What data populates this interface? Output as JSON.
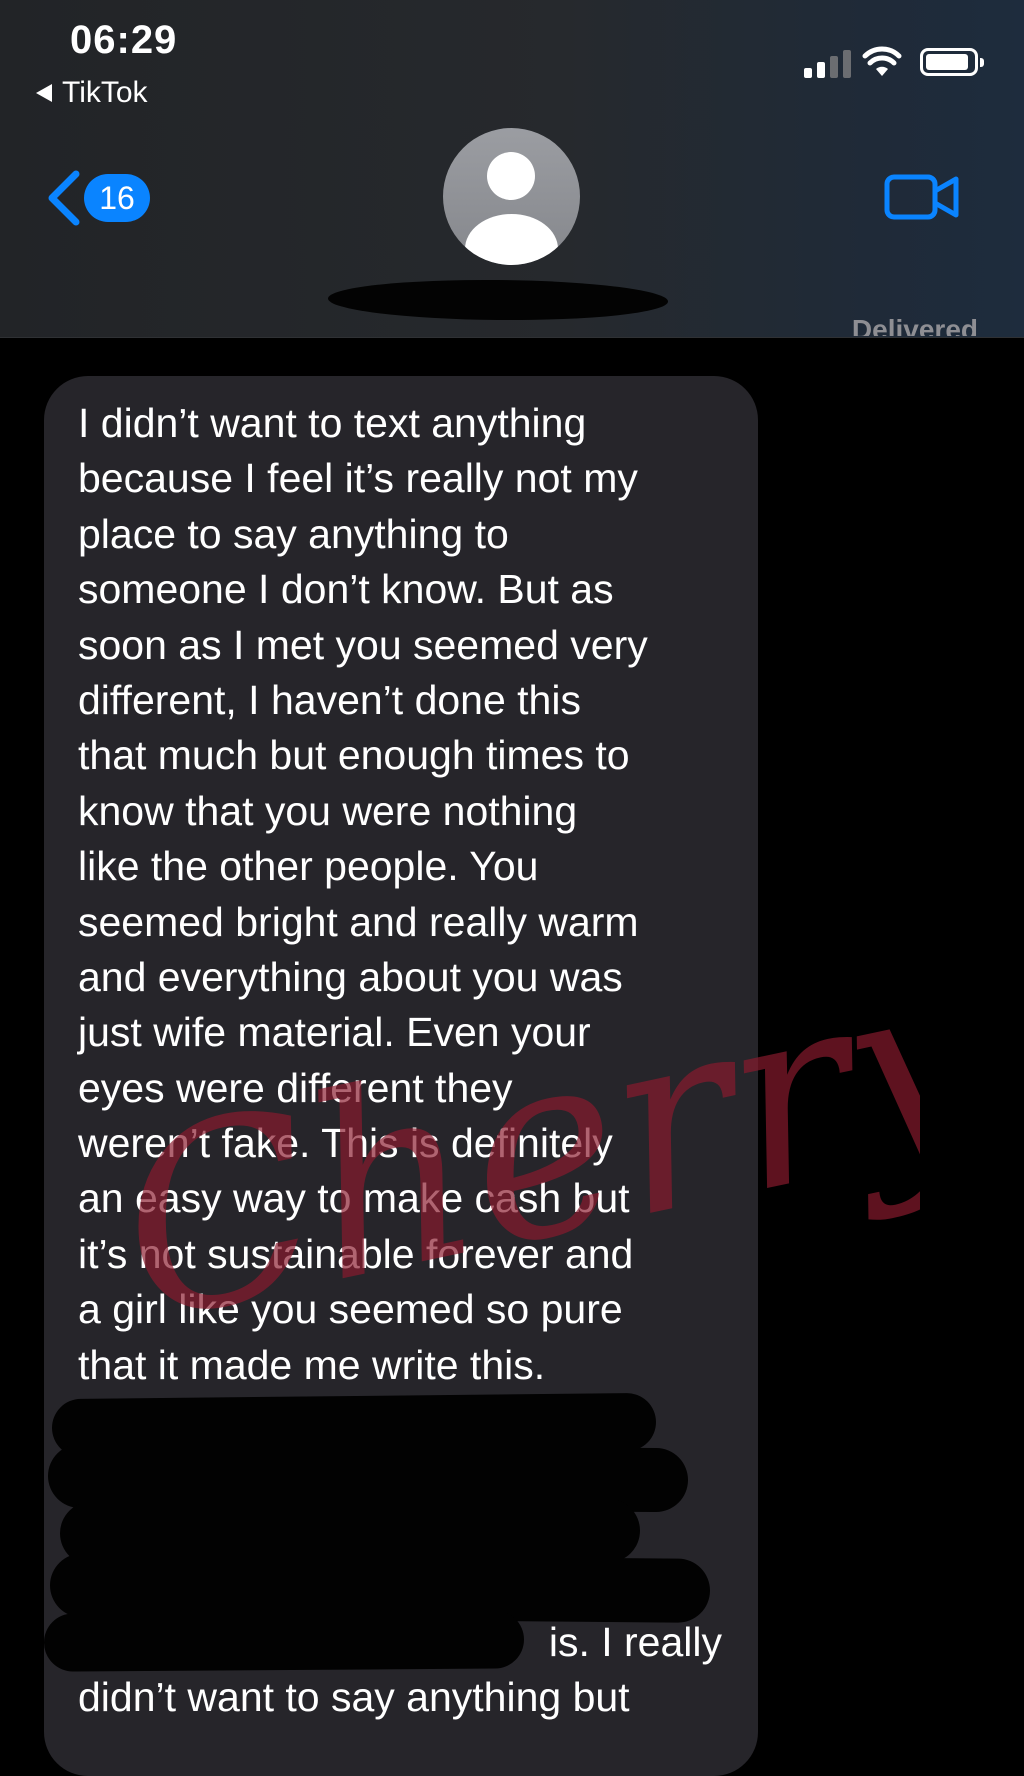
{
  "status_bar": {
    "time": "06:29",
    "back_app": "TikTok",
    "signal_icon": "cellular-signal-icon",
    "wifi_icon": "wifi-icon",
    "battery_icon": "battery-icon"
  },
  "header": {
    "back_icon": "chevron-left-icon",
    "unread_count": "16",
    "avatar_icon": "person-placeholder-icon",
    "video_icon": "facetime-video-icon",
    "accent_color": "#0a84ff"
  },
  "thread": {
    "delivered_label": "Delivered",
    "message_lines": [
      "I didn’t want to text anything",
      "because I feel it’s really not my",
      "place to say anything to",
      "someone I don’t know. But as",
      "soon as I met you seemed very",
      "different, I haven’t done this",
      "that much but enough times to",
      "know that you were nothing",
      "like the other people. You",
      "seemed bright and really warm",
      "and everything about you was",
      "just wife material.  Even your",
      "eyes were different they",
      "weren’t fake. This is definitely",
      "an easy way to make cash but",
      "it’s not sustainable forever and",
      "a girl like you seemed so pure",
      "that it made me write this.",
      "",
      "",
      "",
      "",
      "",
      "didn’t want to say anything but"
    ],
    "partial_line_tail": "is. I really",
    "bubble_color": "#26252a"
  },
  "watermark": {
    "text": "Cherry",
    "color": "#8b1b2e"
  }
}
